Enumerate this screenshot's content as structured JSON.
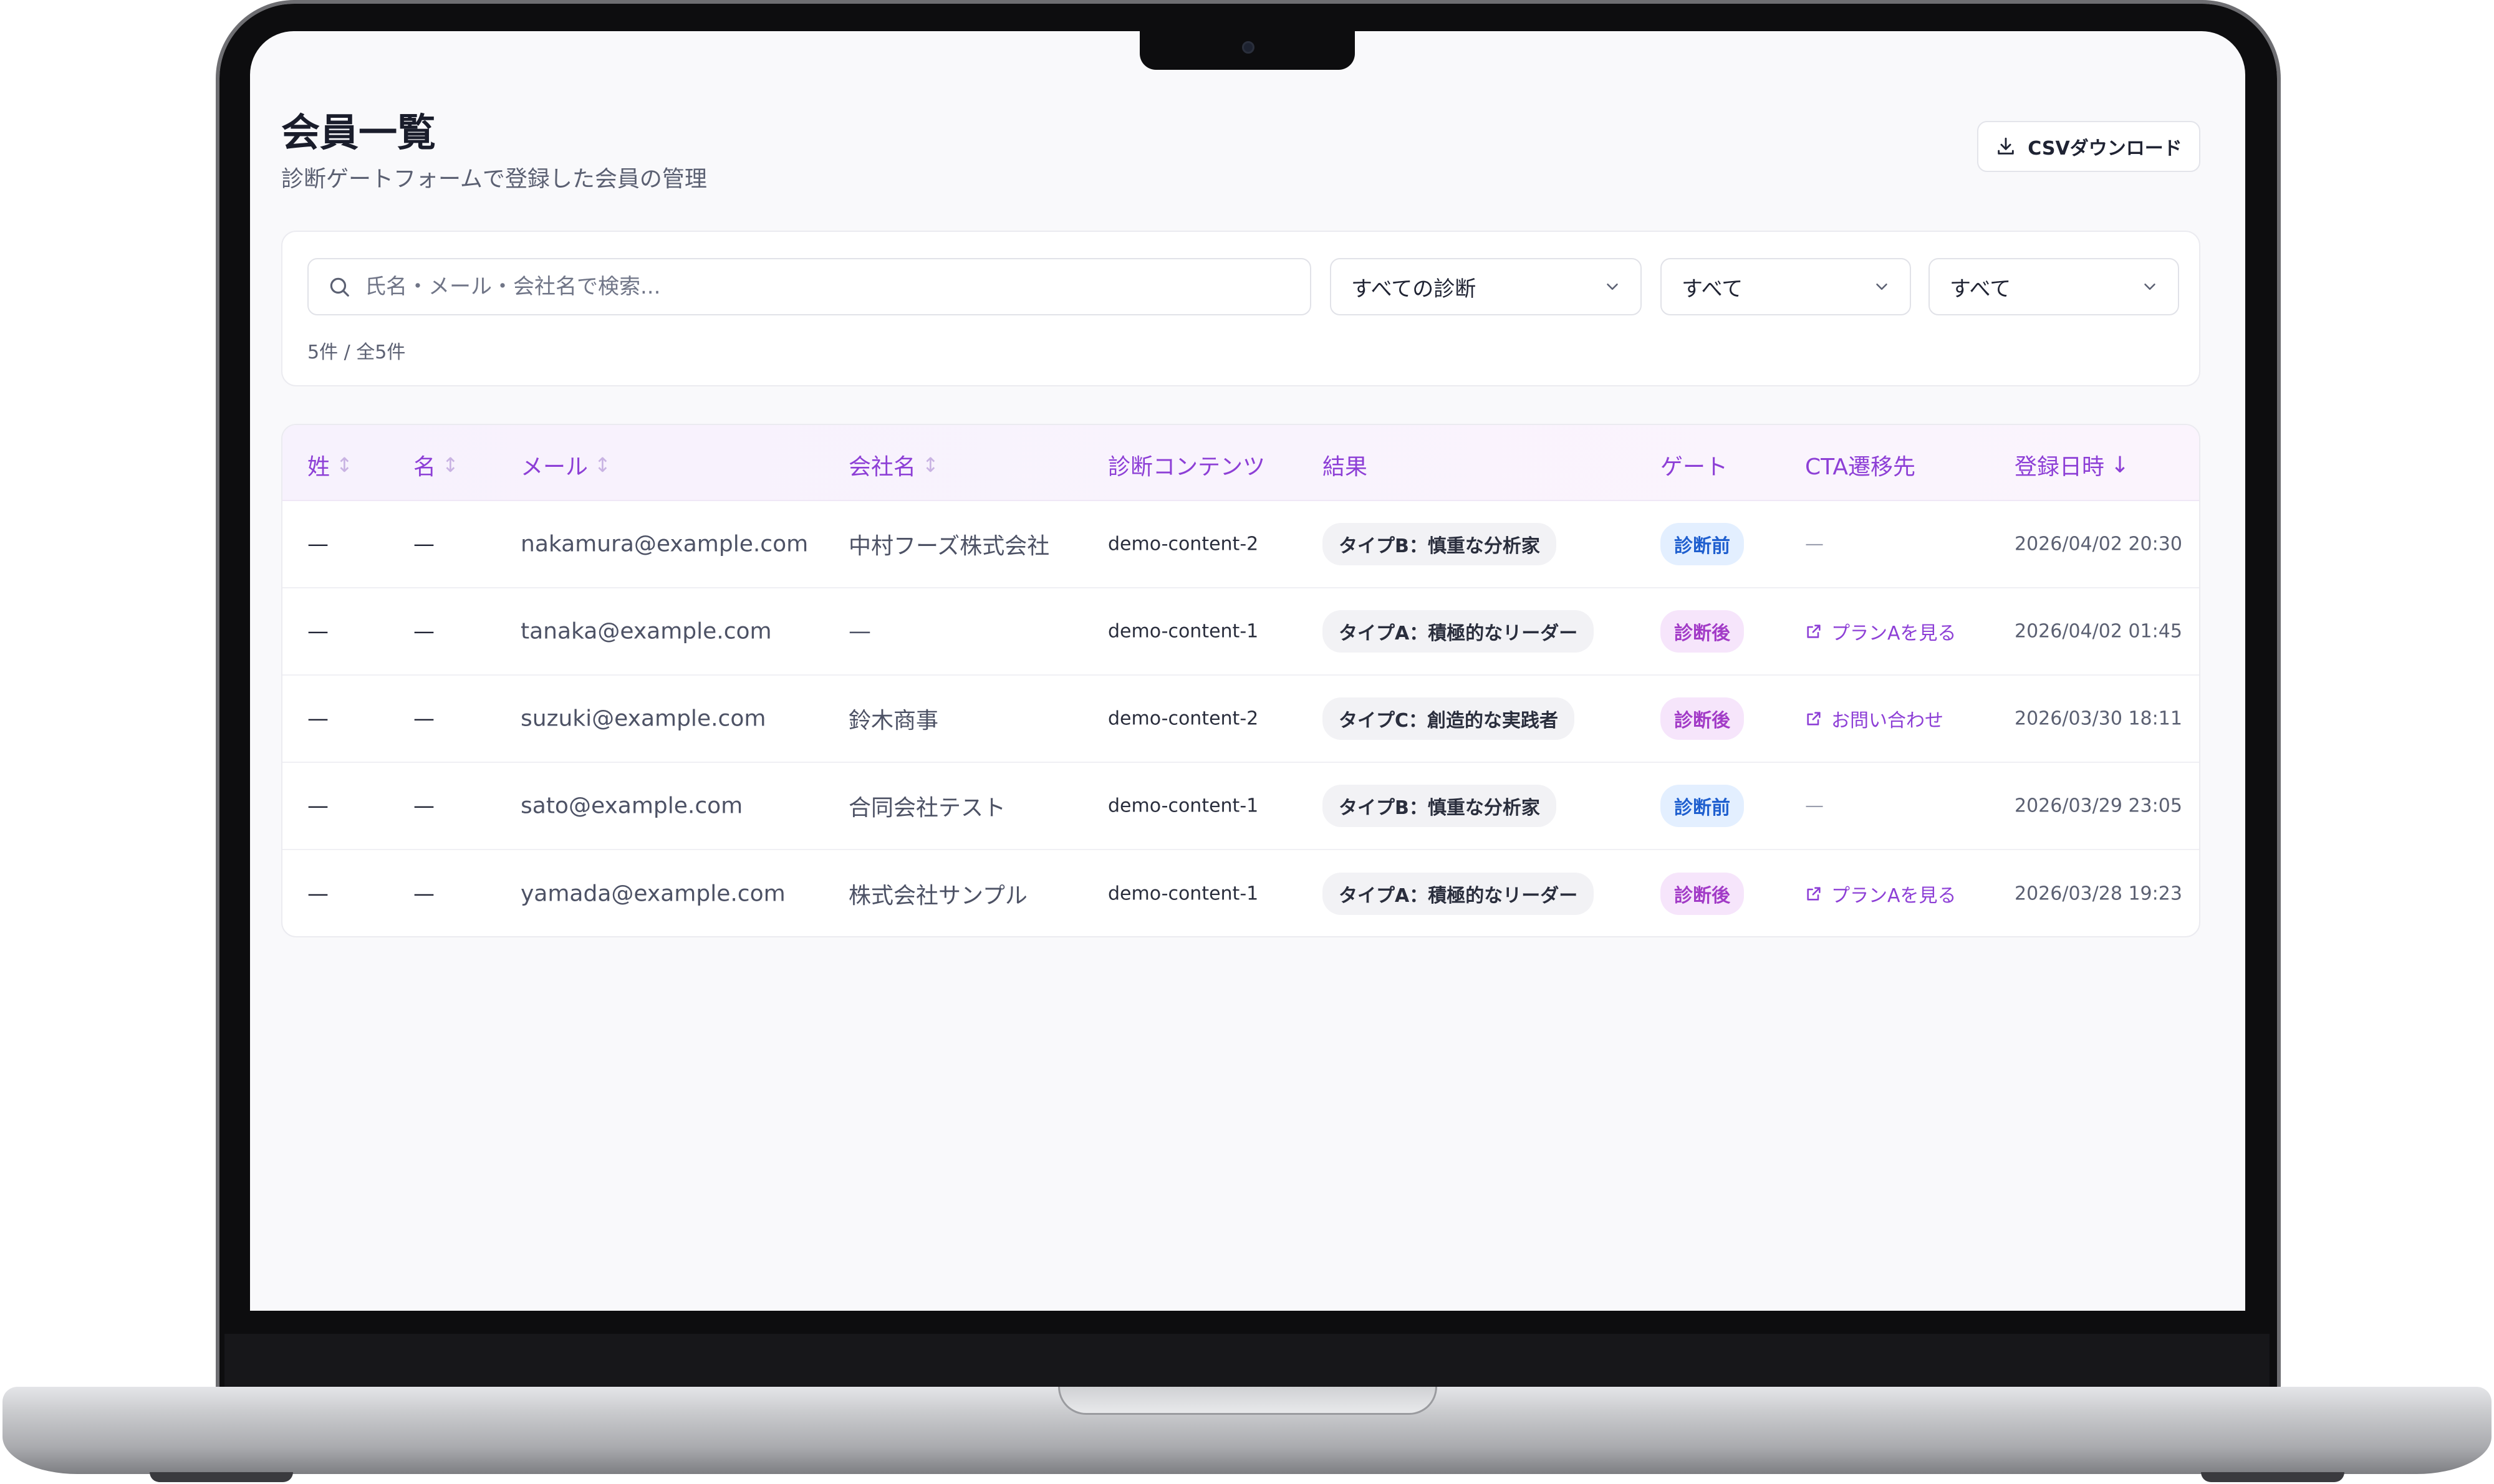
{
  "header": {
    "title": "会員一覧",
    "subtitle": "診断ゲートフォームで登録した会員の管理",
    "csv_button": "CSVダウンロード"
  },
  "filters": {
    "search_placeholder": "氏名・メール・会社名で検索...",
    "diagnosis_select": "すべての診断",
    "gate_select": "すべて",
    "cta_select": "すべて",
    "count_text": "5件 / 全5件"
  },
  "table": {
    "columns": {
      "last_name": "姓",
      "first_name": "名",
      "email": "メール",
      "company": "会社名",
      "content": "診断コンテンツ",
      "result": "結果",
      "gate": "ゲート",
      "cta": "CTA遷移先",
      "registered": "登録日時"
    },
    "sort_icons": {
      "unsorted": "↕",
      "desc": "↓"
    },
    "rows": [
      {
        "last_name": "—",
        "first_name": "—",
        "email": "nakamura@example.com",
        "company": "中村フーズ株式会社",
        "content": "demo-content-2",
        "result": "タイプB：慎重な分析家",
        "gate": "診断前",
        "gate_type": "pre",
        "cta": "—",
        "cta_link": false,
        "registered": "2026/04/02 20:30"
      },
      {
        "last_name": "—",
        "first_name": "—",
        "email": "tanaka@example.com",
        "company": "—",
        "content": "demo-content-1",
        "result": "タイプA：積極的なリーダー",
        "gate": "診断後",
        "gate_type": "post",
        "cta": "プランAを見る",
        "cta_link": true,
        "registered": "2026/04/02 01:45"
      },
      {
        "last_name": "—",
        "first_name": "—",
        "email": "suzuki@example.com",
        "company": "鈴木商事",
        "content": "demo-content-2",
        "result": "タイプC：創造的な実践者",
        "gate": "診断後",
        "gate_type": "post",
        "cta": "お問い合わせ",
        "cta_link": true,
        "registered": "2026/03/30 18:11"
      },
      {
        "last_name": "—",
        "first_name": "—",
        "email": "sato@example.com",
        "company": "合同会社テスト",
        "content": "demo-content-1",
        "result": "タイプB：慎重な分析家",
        "gate": "診断前",
        "gate_type": "pre",
        "cta": "—",
        "cta_link": false,
        "registered": "2026/03/29 23:05"
      },
      {
        "last_name": "—",
        "first_name": "—",
        "email": "yamada@example.com",
        "company": "株式会社サンプル",
        "content": "demo-content-1",
        "result": "タイプA：積極的なリーダー",
        "gate": "診断後",
        "gate_type": "post",
        "cta": "プランAを見る",
        "cta_link": true,
        "registered": "2026/03/28 19:23"
      }
    ]
  },
  "colors": {
    "accent_purple": "#8d3fd6",
    "gate_pre_bg": "#e3efff",
    "gate_pre_text": "#1f5fcf",
    "gate_post_bg": "#f6e5fb",
    "gate_post_text": "#a23bc7"
  },
  "icons": {
    "download": "download-icon",
    "search": "search-icon",
    "chevron": "chevron-down-icon",
    "external_link": "external-link-icon"
  }
}
